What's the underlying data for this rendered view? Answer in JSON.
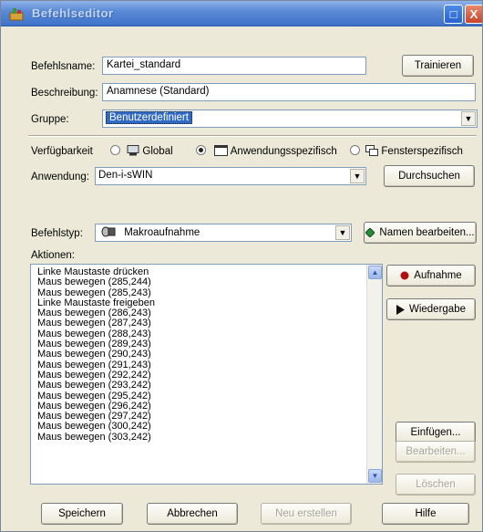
{
  "window": {
    "title": "Befehlseditor",
    "max_glyph": "□",
    "close_glyph": "X"
  },
  "command_name": {
    "label": "Befehlsname:",
    "value": "Kartei_standard"
  },
  "description": {
    "label": "Beschreibung:",
    "value": "Anamnese (Standard)"
  },
  "group": {
    "label": "Gruppe:",
    "value": "Benutzerdefiniert"
  },
  "availability": {
    "label": "Verfügbarkeit",
    "options": [
      {
        "label": "Global",
        "selected": false
      },
      {
        "label": "Anwendungsspezifisch",
        "selected": true
      },
      {
        "label": "Fensterspezifisch",
        "selected": false
      }
    ]
  },
  "application": {
    "label": "Anwendung:",
    "value": "Den-i-sWIN"
  },
  "command_type": {
    "label": "Befehlstyp:",
    "value": "Makroaufnahme"
  },
  "actions": {
    "label": "Aktionen:",
    "items": [
      "Linke Maustaste drücken",
      "Maus bewegen (285,244)",
      "Maus bewegen (285,243)",
      "Linke Maustaste freigeben",
      "Maus bewegen (286,243)",
      "Maus bewegen (287,243)",
      "Maus bewegen (288,243)",
      "Maus bewegen (289,243)",
      "Maus bewegen (290,243)",
      "Maus bewegen (291,243)",
      "Maus bewegen (292,242)",
      "Maus bewegen (293,242)",
      "Maus bewegen (295,242)",
      "Maus bewegen (296,242)",
      "Maus bewegen (297,242)",
      "Maus bewegen (300,242)",
      "Maus bewegen (303,242)"
    ]
  },
  "buttons": {
    "train": "Trainieren",
    "browse": "Durchsuchen",
    "edit_names": "Namen bearbeiten...",
    "record": "Aufnahme",
    "playback": "Wiedergabe",
    "insert": "Einfügen...",
    "edit": "Bearbeiten...",
    "delete": "Löschen",
    "save": "Speichern",
    "cancel": "Abbrechen",
    "new": "Neu erstellen",
    "help": "Hilfe"
  },
  "colors": {
    "titlebar": "#3f73c9",
    "record_dot": "#b01010",
    "selection": "#316ac5"
  }
}
